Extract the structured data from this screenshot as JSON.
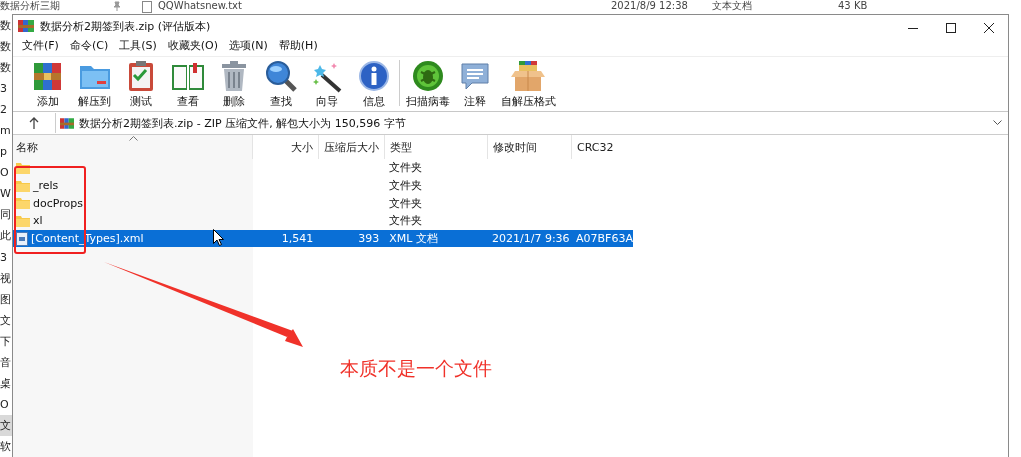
{
  "background_explorer": {
    "top_row": {
      "name": "数据分析三期",
      "file": "QQWhatsnew.txt",
      "modified": "2021/8/9 12:38",
      "type": "文本文档",
      "size": "43 KB"
    },
    "side_items": [
      {
        "label": "数",
        "selected": false
      },
      {
        "label": "数",
        "selected": false
      },
      {
        "label": "数",
        "selected": false
      },
      {
        "label": "3",
        "selected": false
      },
      {
        "label": "2",
        "selected": false
      },
      {
        "label": "m",
        "selected": false
      },
      {
        "label": "p",
        "selected": false
      },
      {
        "label": "O",
        "selected": false
      },
      {
        "label": "W",
        "selected": false
      },
      {
        "label": "同",
        "selected": false
      },
      {
        "label": "此",
        "selected": false
      },
      {
        "label": "3",
        "selected": false
      },
      {
        "label": "视",
        "selected": false
      },
      {
        "label": "图",
        "selected": false
      },
      {
        "label": "文",
        "selected": false
      },
      {
        "label": "下",
        "selected": false
      },
      {
        "label": "音",
        "selected": false
      },
      {
        "label": "桌",
        "selected": false
      },
      {
        "label": "O",
        "selected": false
      },
      {
        "label": "文",
        "selected": true
      },
      {
        "label": "软",
        "selected": false
      }
    ]
  },
  "window": {
    "title": "数据分析2期签到表.zip (评估版本)"
  },
  "menu": [
    "文件(F)",
    "命令(C)",
    "工具(S)",
    "收藏夹(O)",
    "选项(N)",
    "帮助(H)"
  ],
  "toolbar": {
    "groups": [
      [
        "添加",
        "解压到",
        "测试",
        "查看",
        "删除",
        "查找",
        "向导",
        "信息"
      ],
      [
        "扫描病毒",
        "注释",
        "自解压格式"
      ]
    ]
  },
  "address": {
    "path": "数据分析2期签到表.zip - ZIP 压缩文件, 解包大小为 150,596 字节"
  },
  "table": {
    "columns": [
      {
        "label": "名称",
        "sorted": true
      },
      {
        "label": "大小",
        "sorted": false
      },
      {
        "label": "压缩后大小",
        "sorted": false
      },
      {
        "label": "类型",
        "sorted": false
      },
      {
        "label": "修改时间",
        "sorted": false
      },
      {
        "label": "CRC32",
        "sorted": false
      }
    ],
    "rows": [
      {
        "kind": "folder",
        "selected": false,
        "type": "文件夹"
      },
      {
        "kind": "folder",
        "selected": false,
        "name": "_rels",
        "type": "文件夹"
      },
      {
        "kind": "folder",
        "selected": false,
        "name": "docProps",
        "type": "文件夹"
      },
      {
        "kind": "folder",
        "selected": false,
        "name": "xl",
        "type": "文件夹"
      },
      {
        "kind": "file",
        "selected": true,
        "name": "[Content_Types].xml",
        "size": "1,541",
        "packed": "393",
        "type": "XML 文档",
        "modified": "2021/1/7 9:36",
        "crc": "A07BF63A"
      }
    ]
  },
  "annotation": {
    "note": "本质不是一个文件"
  }
}
